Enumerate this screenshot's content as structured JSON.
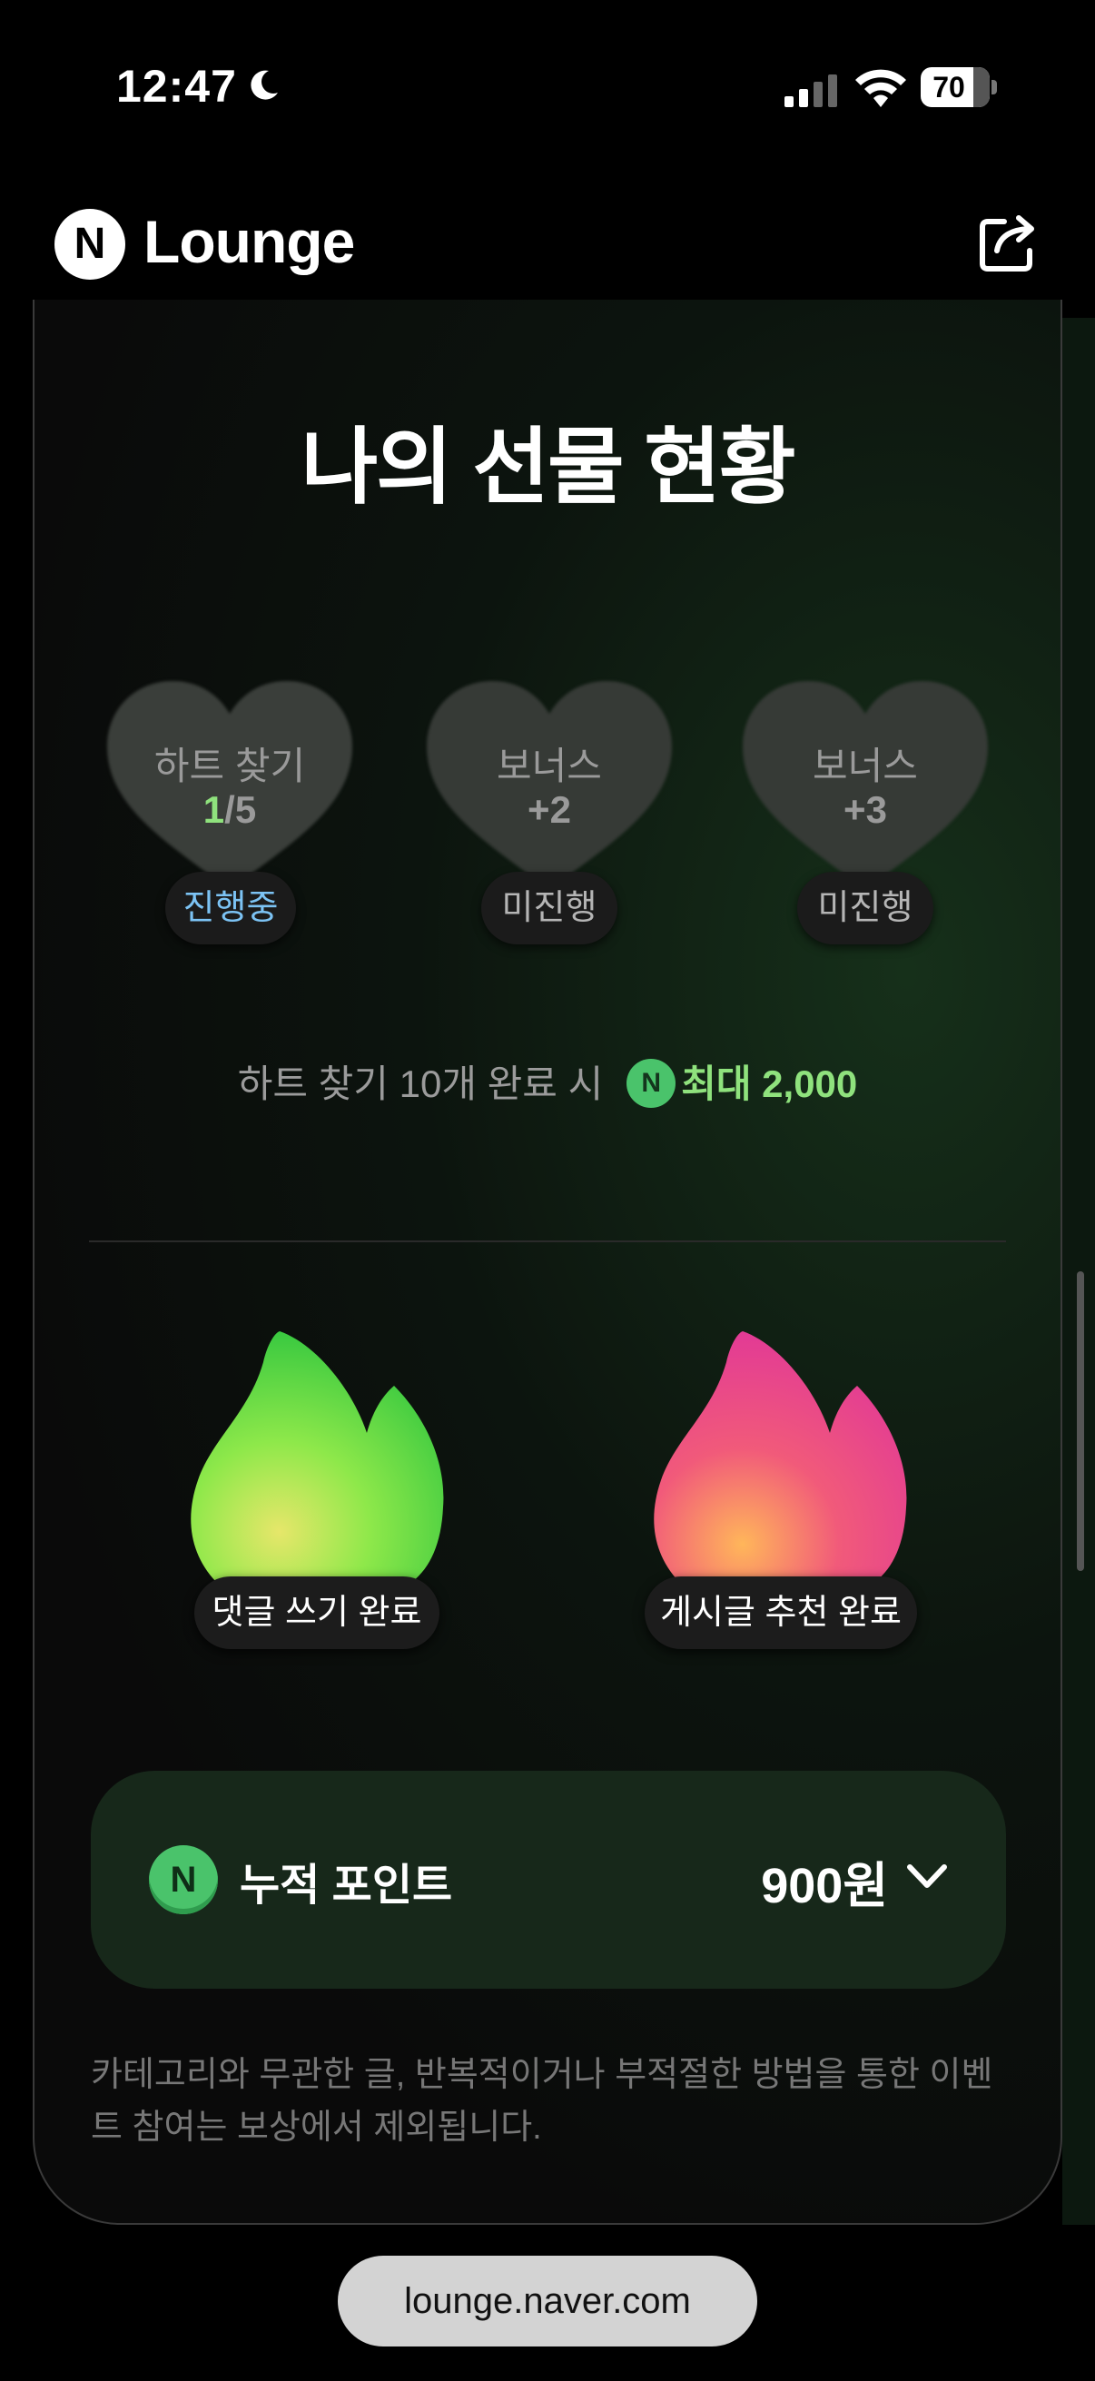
{
  "status_bar": {
    "time": "12:47",
    "battery": "70"
  },
  "header": {
    "logo_letter": "N",
    "brand": "Lounge"
  },
  "card": {
    "title": "나의 선물 현황",
    "hearts": [
      {
        "label": "하트 찾기",
        "value_done": "1",
        "value_rest": "/5",
        "status": "진행중"
      },
      {
        "label": "보너스",
        "value": "+2",
        "status": "미진행"
      },
      {
        "label": "보너스",
        "value": "+3",
        "status": "미진행"
      }
    ],
    "max_reward": {
      "prefix": "하트 찾기 10개 완료 시",
      "coin_letter": "N",
      "amount": "최대 2,000"
    },
    "missions": [
      {
        "label": "댓글 쓰기 완료",
        "color": "green"
      },
      {
        "label": "게시글 추천 완료",
        "color": "pink"
      }
    ],
    "points": {
      "coin_letter": "N",
      "label": "누적 포인트",
      "value": "900원"
    },
    "notice": "카테고리와 무관한 글, 반복적이거나 부적절한 방법을 통한 이벤트 참여는 보상에서 제외됩니다."
  },
  "browser": {
    "url": "lounge.naver.com"
  },
  "colors": {
    "accent_green": "#8fe27d",
    "status_blue": "#7cc3f4",
    "points_bg": "#17281a"
  }
}
